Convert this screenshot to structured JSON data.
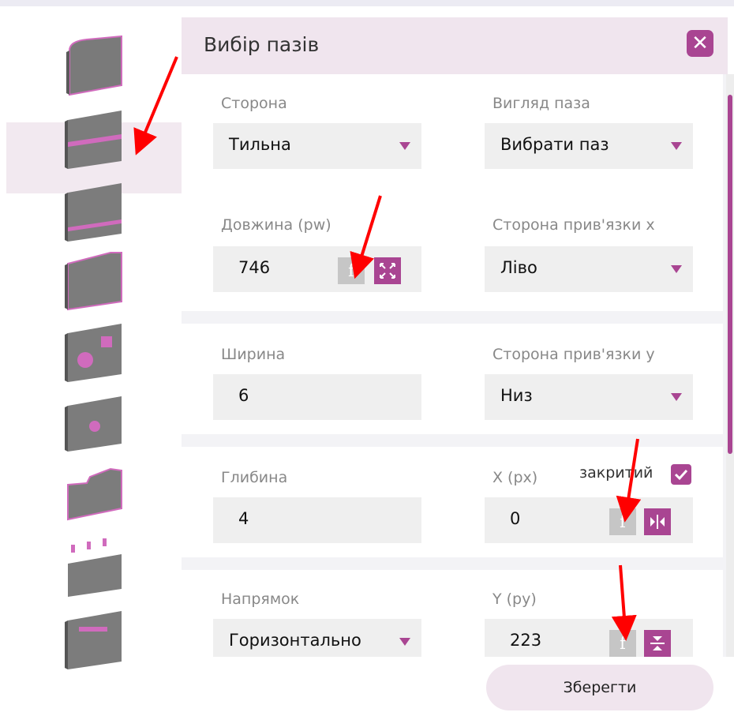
{
  "dialog": {
    "title": "Вибір пазів",
    "close_label": "✕",
    "save_label": "Зберегти"
  },
  "thumbnails": [
    {
      "name": "panel-rounded"
    },
    {
      "name": "panel-groove-middle",
      "selected": true
    },
    {
      "name": "panel-groove-bottom"
    },
    {
      "name": "panel-edge-cut"
    },
    {
      "name": "panel-holes-square-round"
    },
    {
      "name": "panel-round-hole"
    },
    {
      "name": "panel-contour"
    },
    {
      "name": "panel-dowels"
    },
    {
      "name": "panel-handle-slot"
    }
  ],
  "form": {
    "side": {
      "label": "Сторона",
      "value": "Тильна"
    },
    "groove_type": {
      "label": "Вигляд паза",
      "value": "Вибрати паз"
    },
    "length": {
      "label": "Довжина (pw)",
      "value": "746"
    },
    "anchor_x": {
      "label": "Сторона прив'язки x",
      "value": "Ліво"
    },
    "width": {
      "label": "Ширина",
      "value": "6"
    },
    "anchor_y": {
      "label": "Сторона прив'язки y",
      "value": "Низ"
    },
    "depth": {
      "label": "Глибина",
      "value": "4"
    },
    "x": {
      "label": "X (px)",
      "value": "0"
    },
    "closed": {
      "label": "закритий",
      "checked": true
    },
    "direction": {
      "label": "Напрямок",
      "value": "Горизонтально"
    },
    "y": {
      "label": "Y (py)",
      "value": "223"
    },
    "formula_label": "f"
  },
  "colors": {
    "accent": "#a94592",
    "header_bg": "#f0e5ee",
    "field_bg": "#efefef",
    "arrow": "#ff0000"
  }
}
